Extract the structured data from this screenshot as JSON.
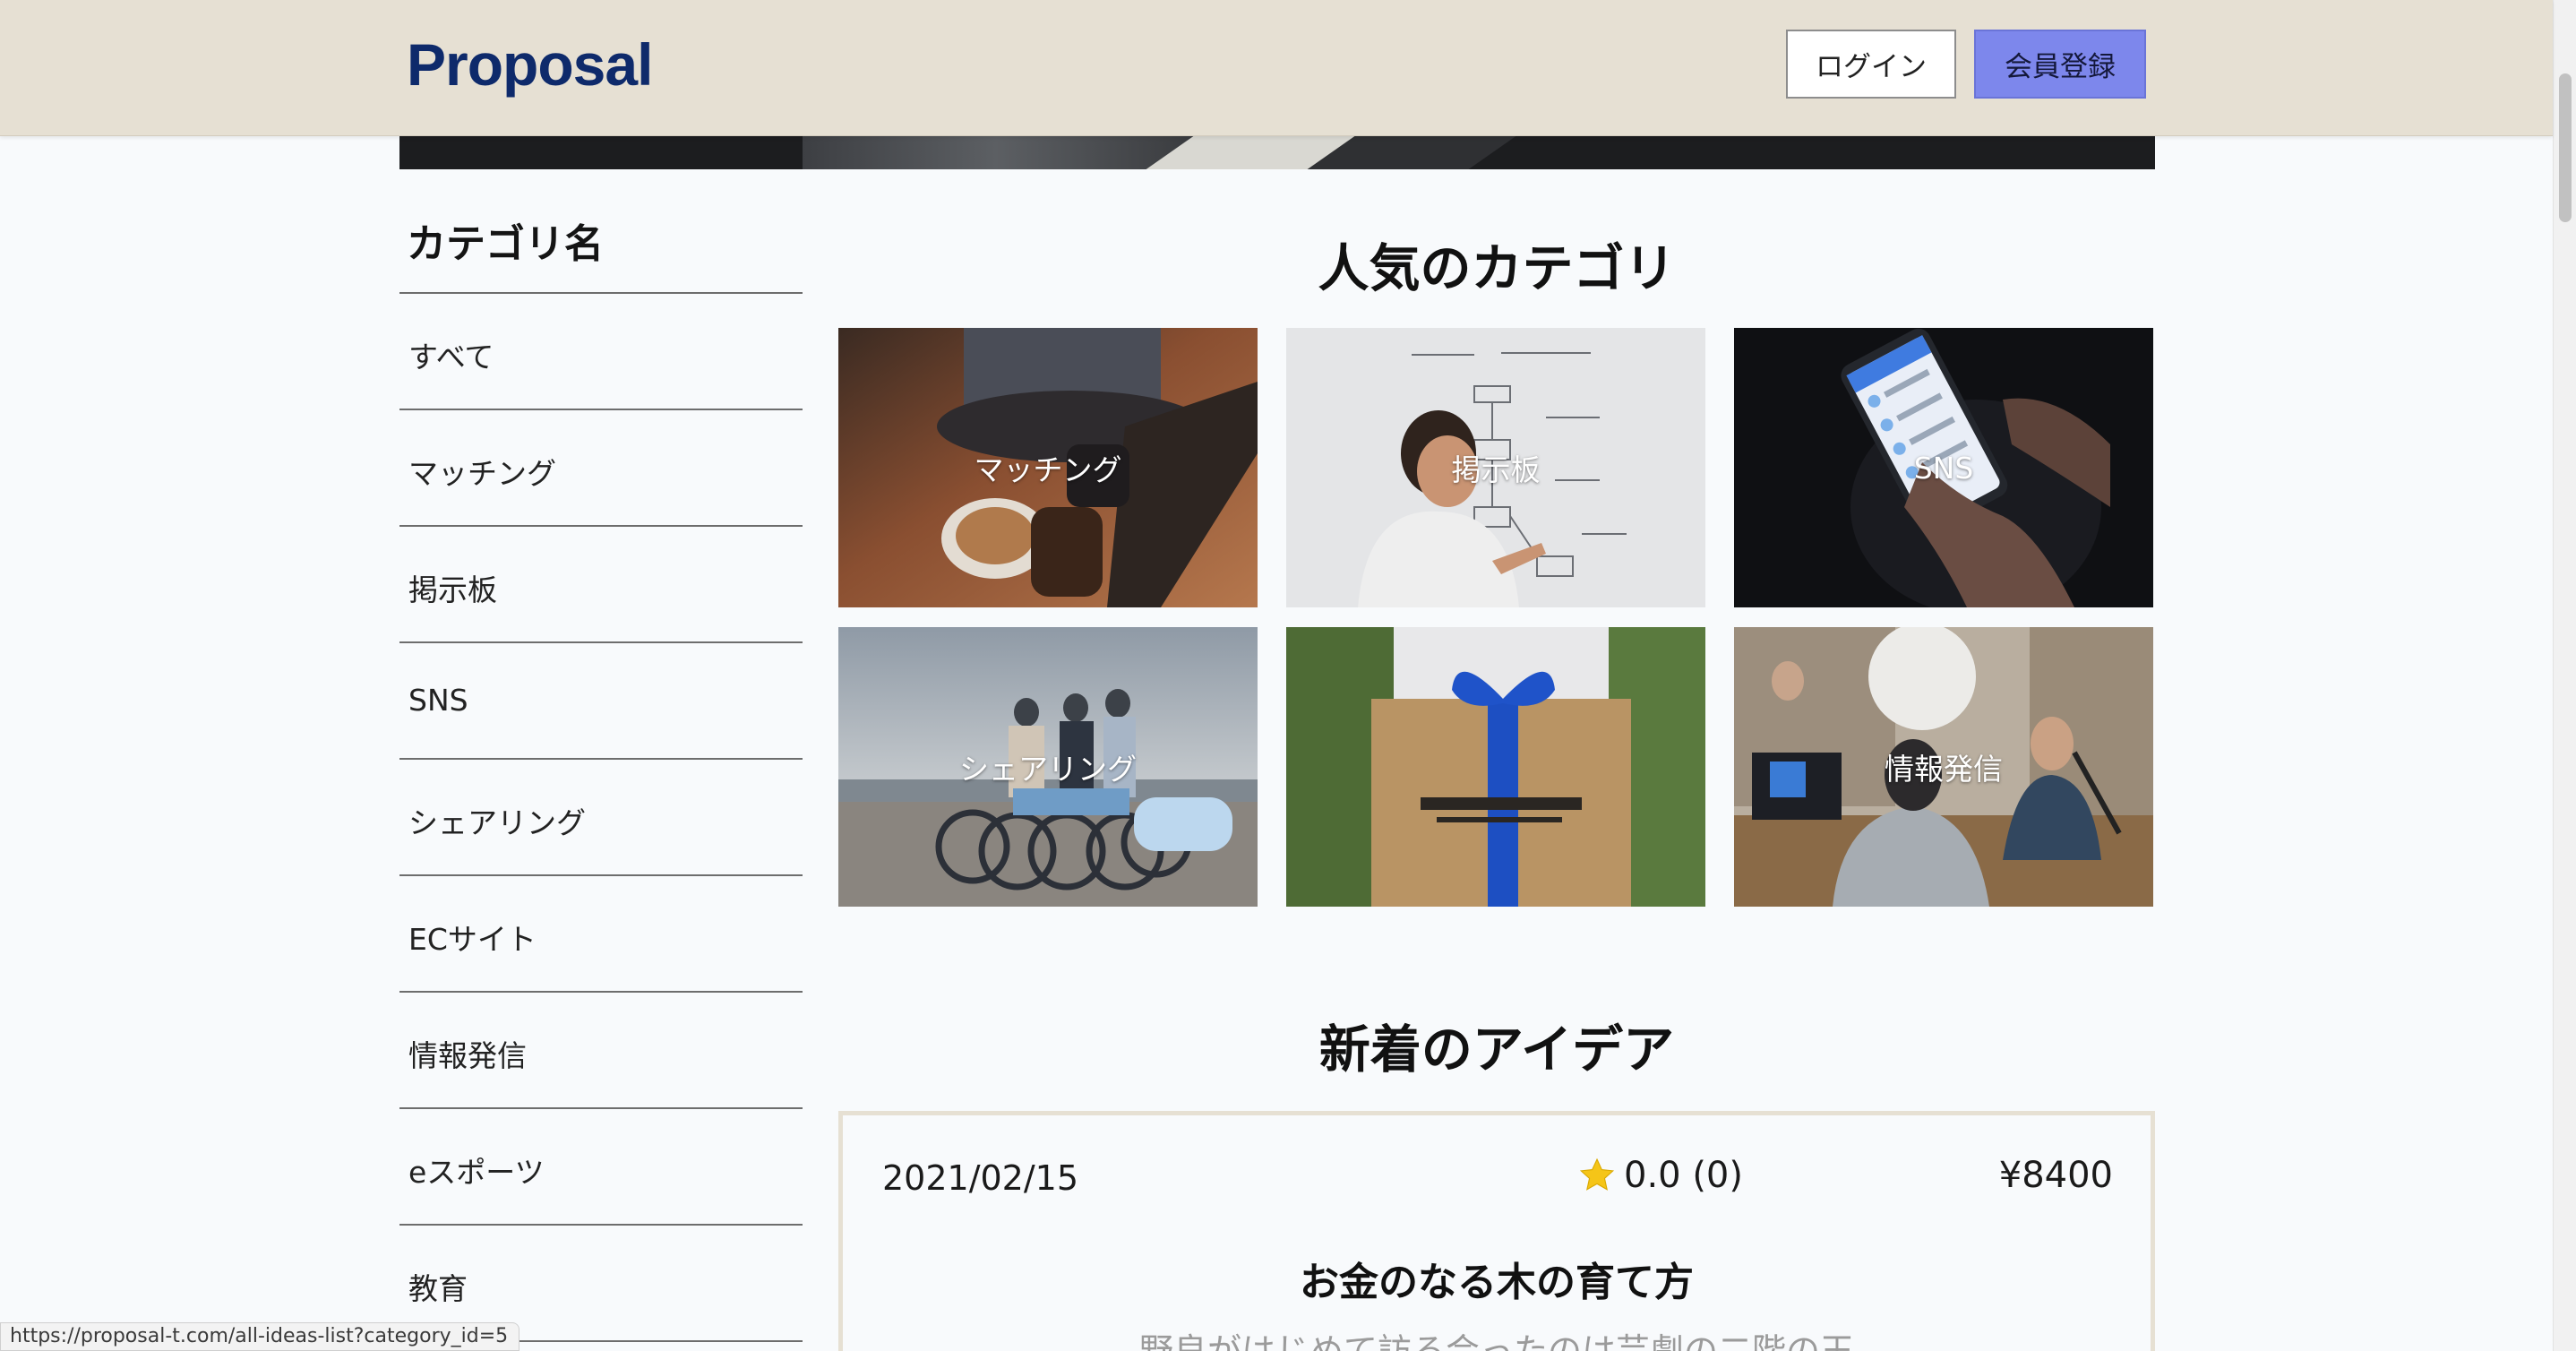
{
  "header": {
    "logo": "Proposal",
    "login_label": "ログイン",
    "register_label": "会員登録"
  },
  "sidebar": {
    "title": "カテゴリ名",
    "items": [
      {
        "label": "すべて"
      },
      {
        "label": "マッチング"
      },
      {
        "label": "掲示板"
      },
      {
        "label": "SNS"
      },
      {
        "label": "シェアリング"
      },
      {
        "label": "ECサイト"
      },
      {
        "label": "情報発信"
      },
      {
        "label": "eスポーツ"
      },
      {
        "label": "教育"
      }
    ]
  },
  "popular": {
    "title": "人気のカテゴリ",
    "tiles": [
      {
        "label": "マッチング"
      },
      {
        "label": "掲示板"
      },
      {
        "label": "SNS"
      },
      {
        "label": "シェアリング"
      },
      {
        "label": ""
      },
      {
        "label": "情報発信"
      }
    ]
  },
  "latest": {
    "title": "新着のアイデア",
    "card": {
      "date": "2021/02/15",
      "rating": "0.0 (0)",
      "price": "¥8400",
      "title": "お金のなる木の育て方",
      "excerpt": "野良がはじめて訪る会ったのは芸劇の二階の王"
    }
  },
  "status_bar": {
    "url": "https://proposal-t.com/all-ideas-list?category_id=5"
  },
  "colors": {
    "header_bg": "#e6e0d3",
    "logo": "#0e2a6b",
    "register_bg": "#7d87ec",
    "star": "#f5c518"
  }
}
